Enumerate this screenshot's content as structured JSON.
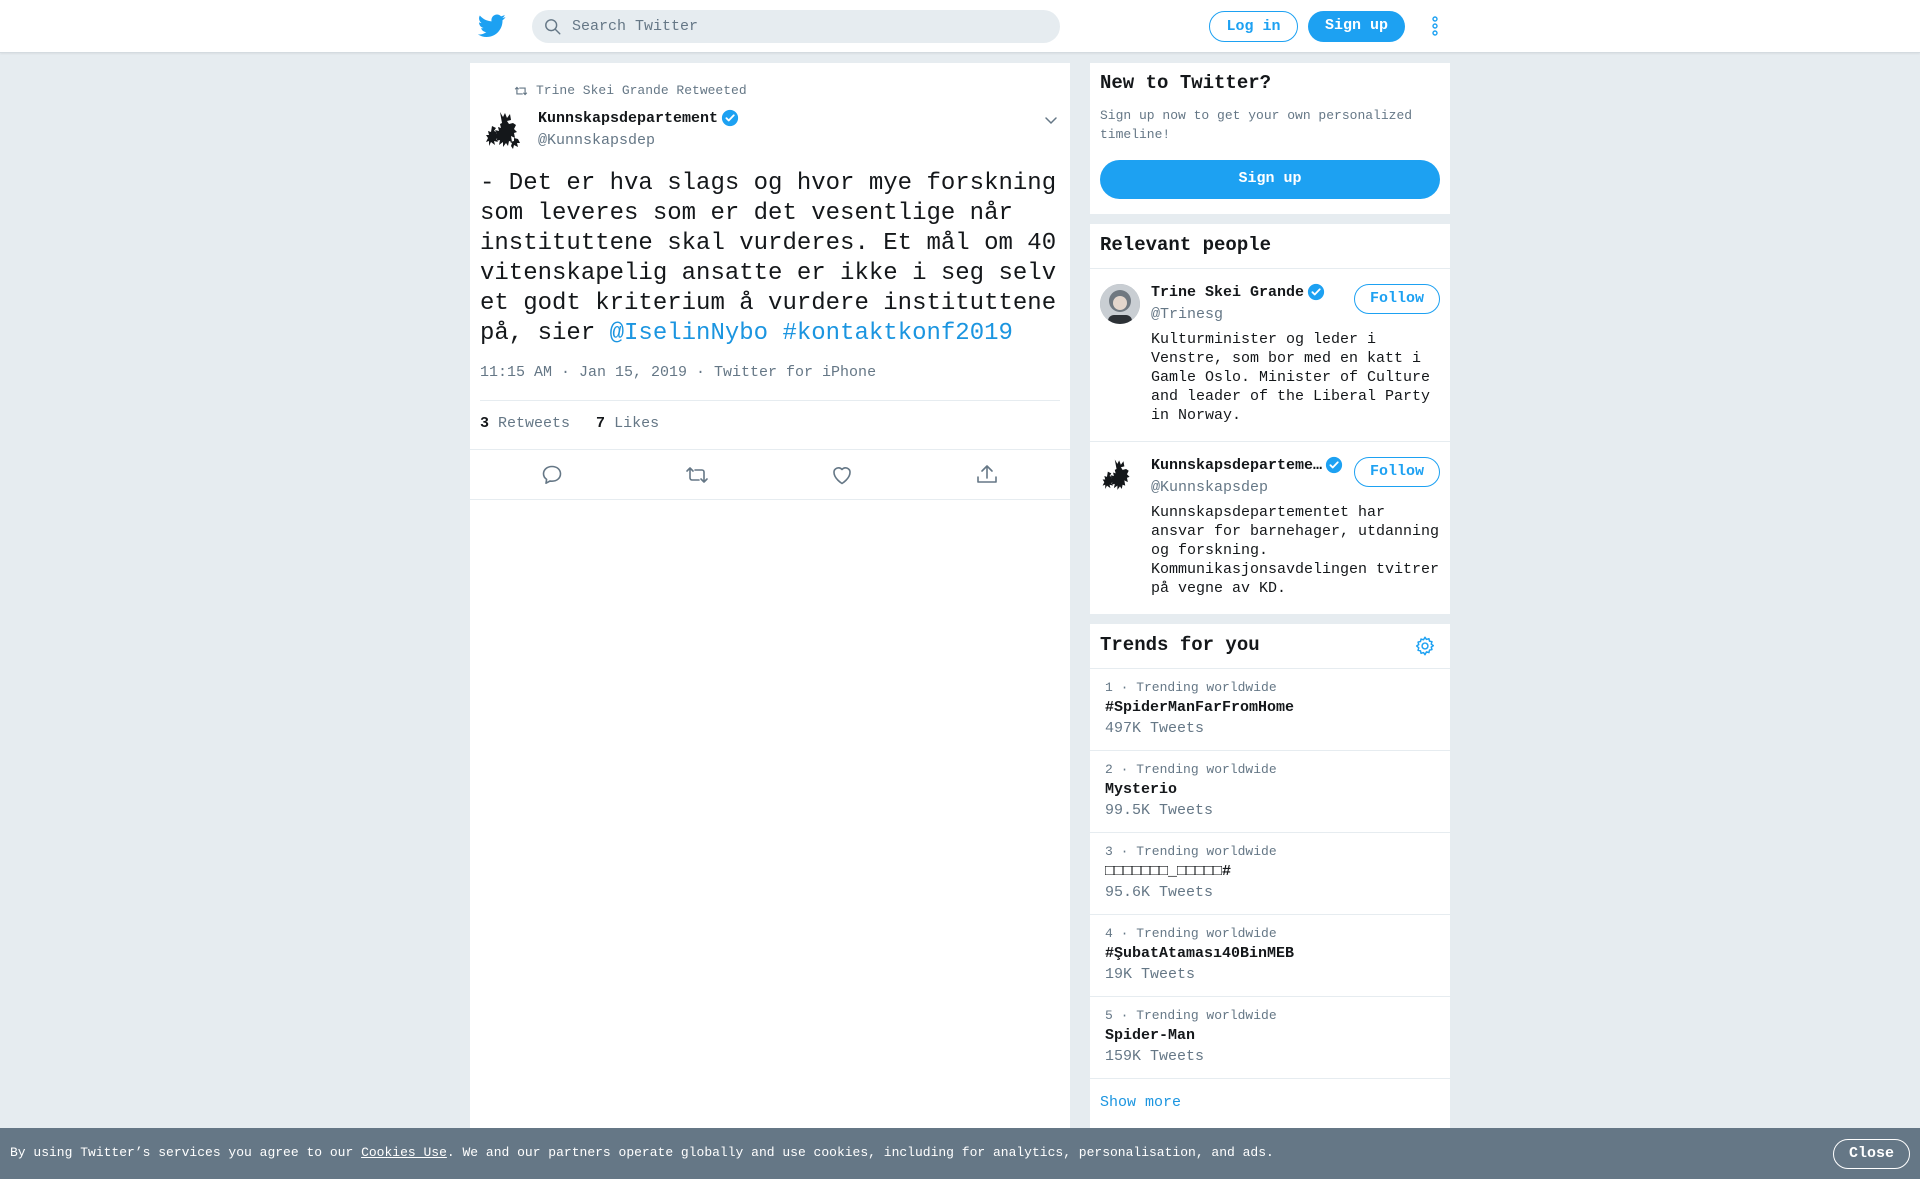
{
  "header": {
    "logo_icon": "twitter-bird-icon",
    "search_placeholder": "Search Twitter",
    "login_label": "Log in",
    "signup_label": "Sign up",
    "more_icon": "more-vertical-icon"
  },
  "tweet": {
    "retweeted_by": "Trine Skei Grande Retweeted",
    "author_name": "Kunnskapsdepartement",
    "author_handle": "@Kunnskapsdep",
    "text_plain": "- Det er hva slags og hvor mye forskning som leveres som er det vesentlige når instituttene skal vurderes. Et mål om 40 vitenskapelig ansatte er ikke i seg selv et godt kriterium å vurdere instituttene på, sier ",
    "mention": "@IselinNybo",
    "hashtag": "#kontaktkonf2019",
    "meta": "11:15 AM · Jan 15, 2019 · Twitter for iPhone",
    "retweets_count": "3",
    "retweets_label": "Retweets",
    "likes_count": "7",
    "likes_label": "Likes"
  },
  "new_to_twitter": {
    "title": "New to Twitter?",
    "text": "Sign up now to get your own personalized timeline!",
    "signup_label": "Sign up"
  },
  "relevant_people": {
    "title": "Relevant people",
    "people": [
      {
        "name": "Trine Skei Grande",
        "handle": "@Trinesg",
        "follow_label": "Follow",
        "bio": "Kulturminister og leder i Venstre, som bor med en katt i Gamle Oslo. Minister of Culture and leader of the Liberal Party in Norway."
      },
      {
        "name": "Kunnskapsdeparteme…",
        "handle": "@Kunnskapsdep",
        "follow_label": "Follow",
        "bio": "Kunnskapsdepartementet har ansvar for barnehager, utdanning og forskning. Kommunikasjonsavdelingen tvitrer på vegne av KD."
      }
    ]
  },
  "trends": {
    "title": "Trends for you",
    "items": [
      {
        "context": "1 · Trending worldwide",
        "name": "#SpiderManFarFromHome",
        "count": "497K Tweets"
      },
      {
        "context": "2 · Trending worldwide",
        "name": "Mysterio",
        "count": "99.5K Tweets"
      },
      {
        "context": "3 · Trending worldwide",
        "name": "□□□□□□□_□□□□□#",
        "count": "95.6K Tweets"
      },
      {
        "context": "4 · Trending worldwide",
        "name": "#ŞubatAtaması40BinMEB",
        "count": "19K Tweets"
      },
      {
        "context": "5 · Trending worldwide",
        "name": "Spider-Man",
        "count": "159K Tweets"
      }
    ],
    "show_more": "Show more"
  },
  "cookie": {
    "text_before": "By using Twitter’s services you agree to our ",
    "link": "Cookies Use",
    "text_after": ". We and our partners operate globally and use cookies, including for analytics, personalisation, and ads.",
    "close_label": "Close"
  },
  "colors": {
    "brand": "#1da1f2",
    "link": "#1b95e0",
    "background": "#e6ecf0",
    "secondary_text": "#657786",
    "cookie_bar": "#657786"
  }
}
